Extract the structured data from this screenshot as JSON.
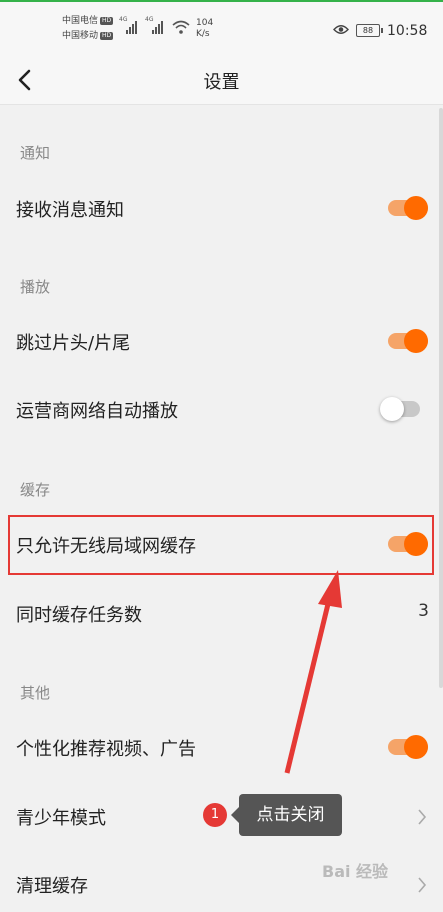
{
  "status_bar": {
    "carrier1": "中国电信",
    "carrier2": "中国移动",
    "hd": "HD",
    "net1": "4G",
    "net2": "4G",
    "speed_value": "104",
    "speed_unit": "K/s",
    "battery": "88",
    "time": "10:58"
  },
  "header": {
    "title": "设置"
  },
  "sections": {
    "notify": "通知",
    "playback": "播放",
    "cache": "缓存",
    "other": "其他"
  },
  "rows": {
    "receive_notify": {
      "label": "接收消息通知",
      "on": true
    },
    "skip_intro": {
      "label": "跳过片头/片尾",
      "on": true
    },
    "carrier_autoplay": {
      "label": "运营商网络自动播放",
      "on": false
    },
    "wifi_only_cache": {
      "label": "只允许无线局域网缓存",
      "on": true
    },
    "concurrent_tasks": {
      "label": "同时缓存任务数",
      "value": "3"
    },
    "personalized": {
      "label": "个性化推荐视频、广告",
      "on": true
    },
    "teen_mode": {
      "label": "青少年模式"
    },
    "clear_cache": {
      "label": "清理缓存"
    }
  },
  "annotation": {
    "badge": "1",
    "tooltip": "点击关闭",
    "color": "#e53935"
  },
  "colors": {
    "accent": "#ff6a00"
  },
  "watermark": "Bai 经验"
}
